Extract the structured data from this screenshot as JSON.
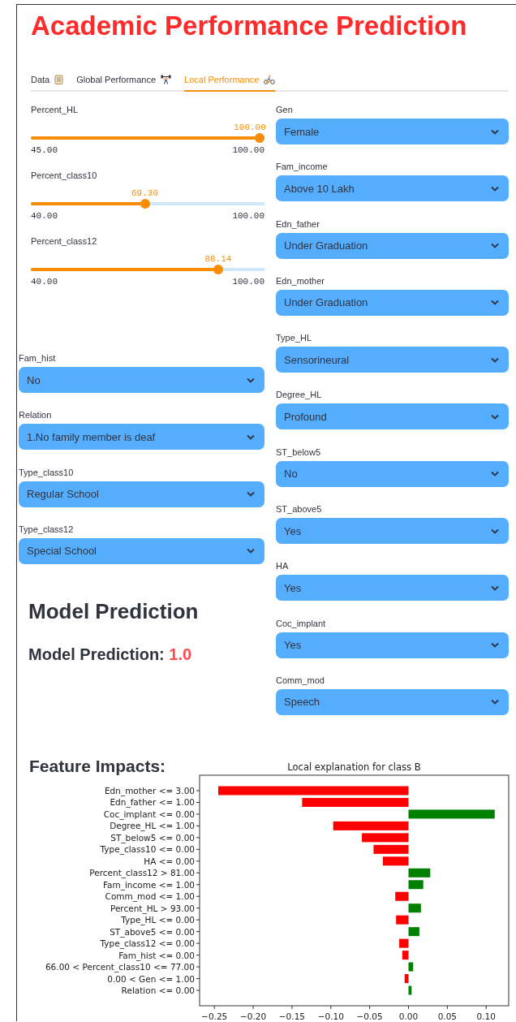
{
  "title": "Academic Performance Prediction",
  "tabs": [
    {
      "label": "Data",
      "selected": false
    },
    {
      "label": "Global Performance",
      "selected": false
    },
    {
      "label": "Local Performance",
      "selected": true
    }
  ],
  "sliders": [
    {
      "label": "Percent_HL",
      "value": "100.00",
      "min": "45.00",
      "max": "100.00",
      "level": 1
    },
    {
      "label": "Percent_class10",
      "value": "69.30",
      "min": "40.00",
      "max": "100.00",
      "level": 0.488
    },
    {
      "label": "Percent_class12",
      "value": "88.14",
      "min": "40.00",
      "max": "100.00",
      "level": 0.802
    }
  ],
  "left_selects": [
    {
      "label": "Fam_hist",
      "value": "No"
    },
    {
      "label": "Relation",
      "value": "1.No family member is deaf"
    },
    {
      "label": "Type_class10",
      "value": "Regular School"
    },
    {
      "label": "Type_class12",
      "value": "Special School"
    }
  ],
  "prediction": {
    "heading": "Model Prediction",
    "label": "Model Prediction:",
    "value": "1.0"
  },
  "right_selects": [
    {
      "label": "Gen",
      "value": "Female"
    },
    {
      "label": "Fam_income",
      "value": "Above 10 Lakh"
    },
    {
      "label": "Edn_father",
      "value": "Under Graduation"
    },
    {
      "label": "Edn_mother",
      "value": "Under Graduation"
    },
    {
      "label": "Type_HL",
      "value": "Sensorineural"
    },
    {
      "label": "Degree_HL",
      "value": "Profound"
    },
    {
      "label": "ST_below5",
      "value": "No"
    },
    {
      "label": "ST_above5",
      "value": "Yes"
    },
    {
      "label": "HA",
      "value": "Yes"
    },
    {
      "label": "Coc_implant",
      "value": "Yes"
    },
    {
      "label": "Comm_mod",
      "value": "Speech"
    }
  ],
  "feature_impacts": {
    "heading": "Feature Impacts:",
    "chart_data": {
      "type": "bar",
      "orientation": "horizontal",
      "title": "Local explanation for class B",
      "categories": [
        "Edn_mother <= 3.00",
        "Edn_father <= 1.00",
        "Coc_implant <= 0.00",
        "Degree_HL <= 1.00",
        "ST_below5 <= 0.00",
        "Type_class10 <= 0.00",
        "HA <= 0.00",
        "Percent_class12 > 81.00",
        "Fam_income <= 1.00",
        "Comm_mod <= 1.00",
        "Percent_HL > 93.00",
        "Type_HL <= 0.00",
        "ST_above5 <= 0.00",
        "Type_class12 <= 0.00",
        "Fam_hist <= 0.00",
        "66.00 < Percent_class10 <= 77.00",
        "0.00 < Gen <= 1.00",
        "Relation <= 0.00"
      ],
      "values": [
        -0.245,
        -0.137,
        0.111,
        -0.097,
        -0.06,
        -0.045,
        -0.033,
        0.028,
        0.019,
        -0.017,
        0.016,
        -0.016,
        0.014,
        -0.012,
        -0.008,
        0.006,
        -0.005,
        0.004
      ],
      "xlim": [
        -0.269,
        0.129
      ],
      "xticks": [
        {
          "value": -0.25,
          "label": "−0.25"
        },
        {
          "value": -0.2,
          "label": "−0.20"
        },
        {
          "value": -0.15,
          "label": "−0.15"
        },
        {
          "value": -0.1,
          "label": "−0.10"
        },
        {
          "value": -0.05,
          "label": "−0.05"
        },
        {
          "value": 0,
          "label": "0.00"
        },
        {
          "value": 0.05,
          "label": "0.05"
        },
        {
          "value": 0.1,
          "label": "0.10"
        }
      ]
    }
  }
}
